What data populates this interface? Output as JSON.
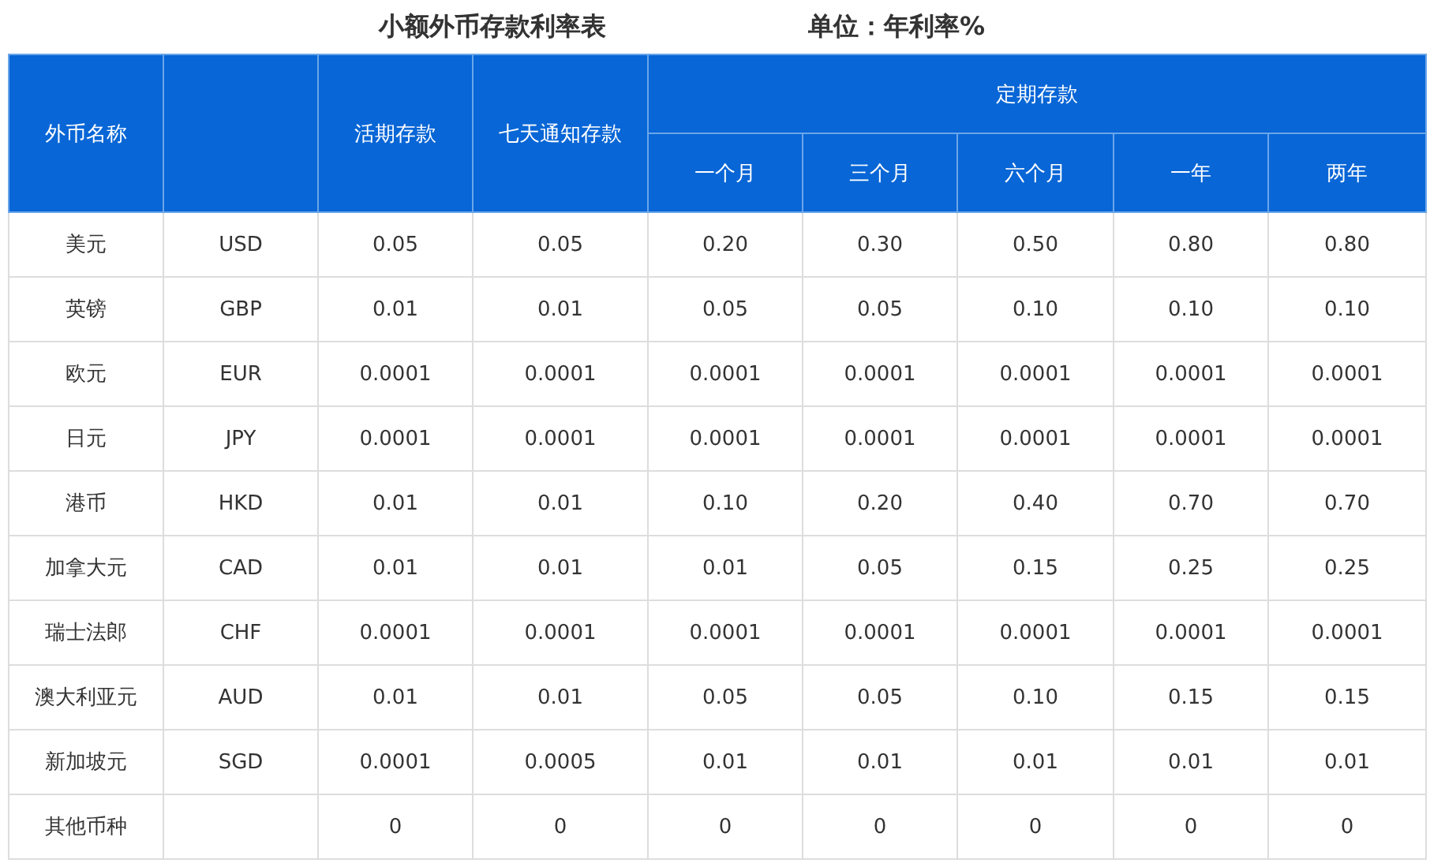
{
  "title": "小额外币存款利率表",
  "unit": "单位：年利率%",
  "header": {
    "name": "外币名称",
    "current": "活期存款",
    "seven_day": "七天通知存款",
    "fixed": "定期存款",
    "terms": [
      "一个月",
      "三个月",
      "六个月",
      "一年",
      "两年"
    ]
  },
  "rows": [
    {
      "name": "美元",
      "code": "USD",
      "values": [
        "0.05",
        "0.05",
        "0.20",
        "0.30",
        "0.50",
        "0.80",
        "0.80"
      ]
    },
    {
      "name": "英镑",
      "code": "GBP",
      "values": [
        "0.01",
        "0.01",
        "0.05",
        "0.05",
        "0.10",
        "0.10",
        "0.10"
      ]
    },
    {
      "name": "欧元",
      "code": "EUR",
      "values": [
        "0.0001",
        "0.0001",
        "0.0001",
        "0.0001",
        "0.0001",
        "0.0001",
        "0.0001"
      ]
    },
    {
      "name": "日元",
      "code": "JPY",
      "values": [
        "0.0001",
        "0.0001",
        "0.0001",
        "0.0001",
        "0.0001",
        "0.0001",
        "0.0001"
      ]
    },
    {
      "name": "港币",
      "code": "HKD",
      "values": [
        "0.01",
        "0.01",
        "0.10",
        "0.20",
        "0.40",
        "0.70",
        "0.70"
      ]
    },
    {
      "name": "加拿大元",
      "code": "CAD",
      "values": [
        "0.01",
        "0.01",
        "0.01",
        "0.05",
        "0.15",
        "0.25",
        "0.25"
      ]
    },
    {
      "name": "瑞士法郎",
      "code": "CHF",
      "values": [
        "0.0001",
        "0.0001",
        "0.0001",
        "0.0001",
        "0.0001",
        "0.0001",
        "0.0001"
      ]
    },
    {
      "name": "澳大利亚元",
      "code": "AUD",
      "values": [
        "0.01",
        "0.01",
        "0.05",
        "0.05",
        "0.10",
        "0.15",
        "0.15"
      ]
    },
    {
      "name": "新加坡元",
      "code": "SGD",
      "values": [
        "0.0001",
        "0.0005",
        "0.01",
        "0.01",
        "0.01",
        "0.01",
        "0.01"
      ]
    },
    {
      "name": "其他币种",
      "values": [
        "0",
        "0",
        "0",
        "0",
        "0",
        "0",
        "0"
      ]
    }
  ]
}
